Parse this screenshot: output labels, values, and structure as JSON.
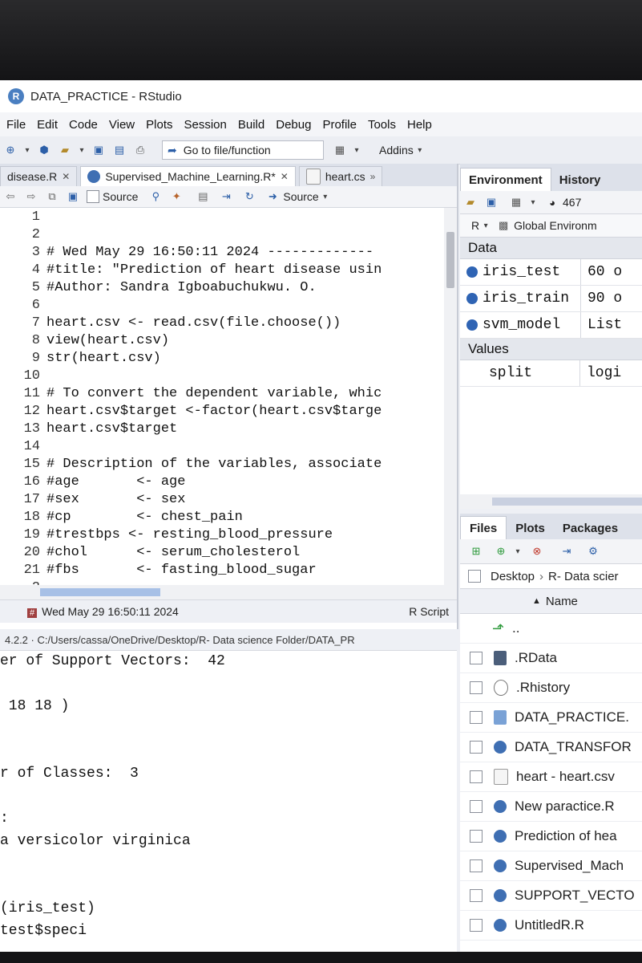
{
  "window": {
    "title": "DATA_PRACTICE - RStudio",
    "logo": "R"
  },
  "menu": [
    "File",
    "Edit",
    "Code",
    "View",
    "Plots",
    "Session",
    "Build",
    "Debug",
    "Profile",
    "Tools",
    "Help"
  ],
  "toolbar": {
    "goto_label": "Go to file/function",
    "addins_label": "Addins"
  },
  "editor": {
    "tabs": [
      {
        "label": "disease.R",
        "close": "✕"
      },
      {
        "label": "Supervised_Machine_Learning.R*",
        "close": "✕"
      },
      {
        "label": "heart.cs",
        "close": "»"
      }
    ],
    "source_checkbox_label": "Source",
    "source_button_label": "Source",
    "lines": [
      {
        "n": "1",
        "t": ""
      },
      {
        "n": "2",
        "t": ""
      },
      {
        "n": "3",
        "t": "# Wed May 29 16:50:11 2024 -------------"
      },
      {
        "n": "4",
        "t": "#title: \"Prediction of heart disease usin"
      },
      {
        "n": "5",
        "t": "#Author: Sandra Igboabuchukwu. O."
      },
      {
        "n": "6",
        "t": ""
      },
      {
        "n": "7",
        "t": "heart.csv <- read.csv(file.choose())"
      },
      {
        "n": "8",
        "t": "view(heart.csv)"
      },
      {
        "n": "9",
        "t": "str(heart.csv)"
      },
      {
        "n": "10",
        "t": ""
      },
      {
        "n": "11",
        "t": "# To convert the dependent variable, whic"
      },
      {
        "n": "12",
        "t": "heart.csv$target <-factor(heart.csv$targe"
      },
      {
        "n": "13",
        "t": "heart.csv$target"
      },
      {
        "n": "14",
        "t": ""
      },
      {
        "n": "15",
        "t": "# Description of the variables, associate"
      },
      {
        "n": "16",
        "t": "#age       <- age"
      },
      {
        "n": "17",
        "t": "#sex       <- sex"
      },
      {
        "n": "18",
        "t": "#cp        <- chest_pain"
      },
      {
        "n": "19",
        "t": "#trestbps <- resting_blood_pressure"
      },
      {
        "n": "20",
        "t": "#chol      <- serum_cholesterol"
      },
      {
        "n": "21",
        "t": "#fbs       <- fasting_blood_sugar"
      },
      {
        "n": "2",
        "t": ""
      }
    ],
    "status_section": "Wed May 29 16:50:11 2024",
    "status_type": "R Script"
  },
  "console": {
    "header": "4.2.2 · C:/Users/cassa/OneDrive/Desktop/R- Data science Folder/DATA_PR",
    "lines": [
      "er of Support Vectors:  42",
      "",
      " 18 18 )",
      "",
      "",
      "r of Classes:  3",
      "",
      ":",
      "a versicolor virginica",
      "",
      "",
      "(iris_test)",
      "test$speci"
    ]
  },
  "environment": {
    "tabs": [
      "Environment",
      "History"
    ],
    "memory": "467",
    "lang": "R",
    "scope": "Global Environm",
    "data_header": "Data",
    "data_rows": [
      {
        "name": "iris_test",
        "value": "60 o"
      },
      {
        "name": "iris_train",
        "value": "90 o"
      },
      {
        "name": "svm_model",
        "value": "List"
      }
    ],
    "values_header": "Values",
    "value_rows": [
      {
        "name": "split",
        "value": "logi"
      }
    ]
  },
  "files": {
    "tabs": [
      "Files",
      "Plots",
      "Packages"
    ],
    "breadcrumb": [
      "Desktop",
      "R- Data scier"
    ],
    "name_header": "Name",
    "parent": "..",
    "items": [
      {
        "name": ".RData",
        "icon": "rdata-icon"
      },
      {
        "name": ".Rhistory",
        "icon": "history-icon"
      },
      {
        "name": "DATA_PRACTICE.",
        "icon": "rproj-icon"
      },
      {
        "name": "DATA_TRANSFOR",
        "icon": "r-file-icon"
      },
      {
        "name": "heart - heart.csv",
        "icon": "csv-icon"
      },
      {
        "name": "New paractice.R",
        "icon": "r-file-icon"
      },
      {
        "name": "Prediction of hea",
        "icon": "r-file-icon"
      },
      {
        "name": "Supervised_Mach",
        "icon": "r-file-icon"
      },
      {
        "name": "SUPPORT_VECTO",
        "icon": "r-file-icon"
      },
      {
        "name": "UntitledR.R",
        "icon": "r-file-icon"
      }
    ]
  }
}
